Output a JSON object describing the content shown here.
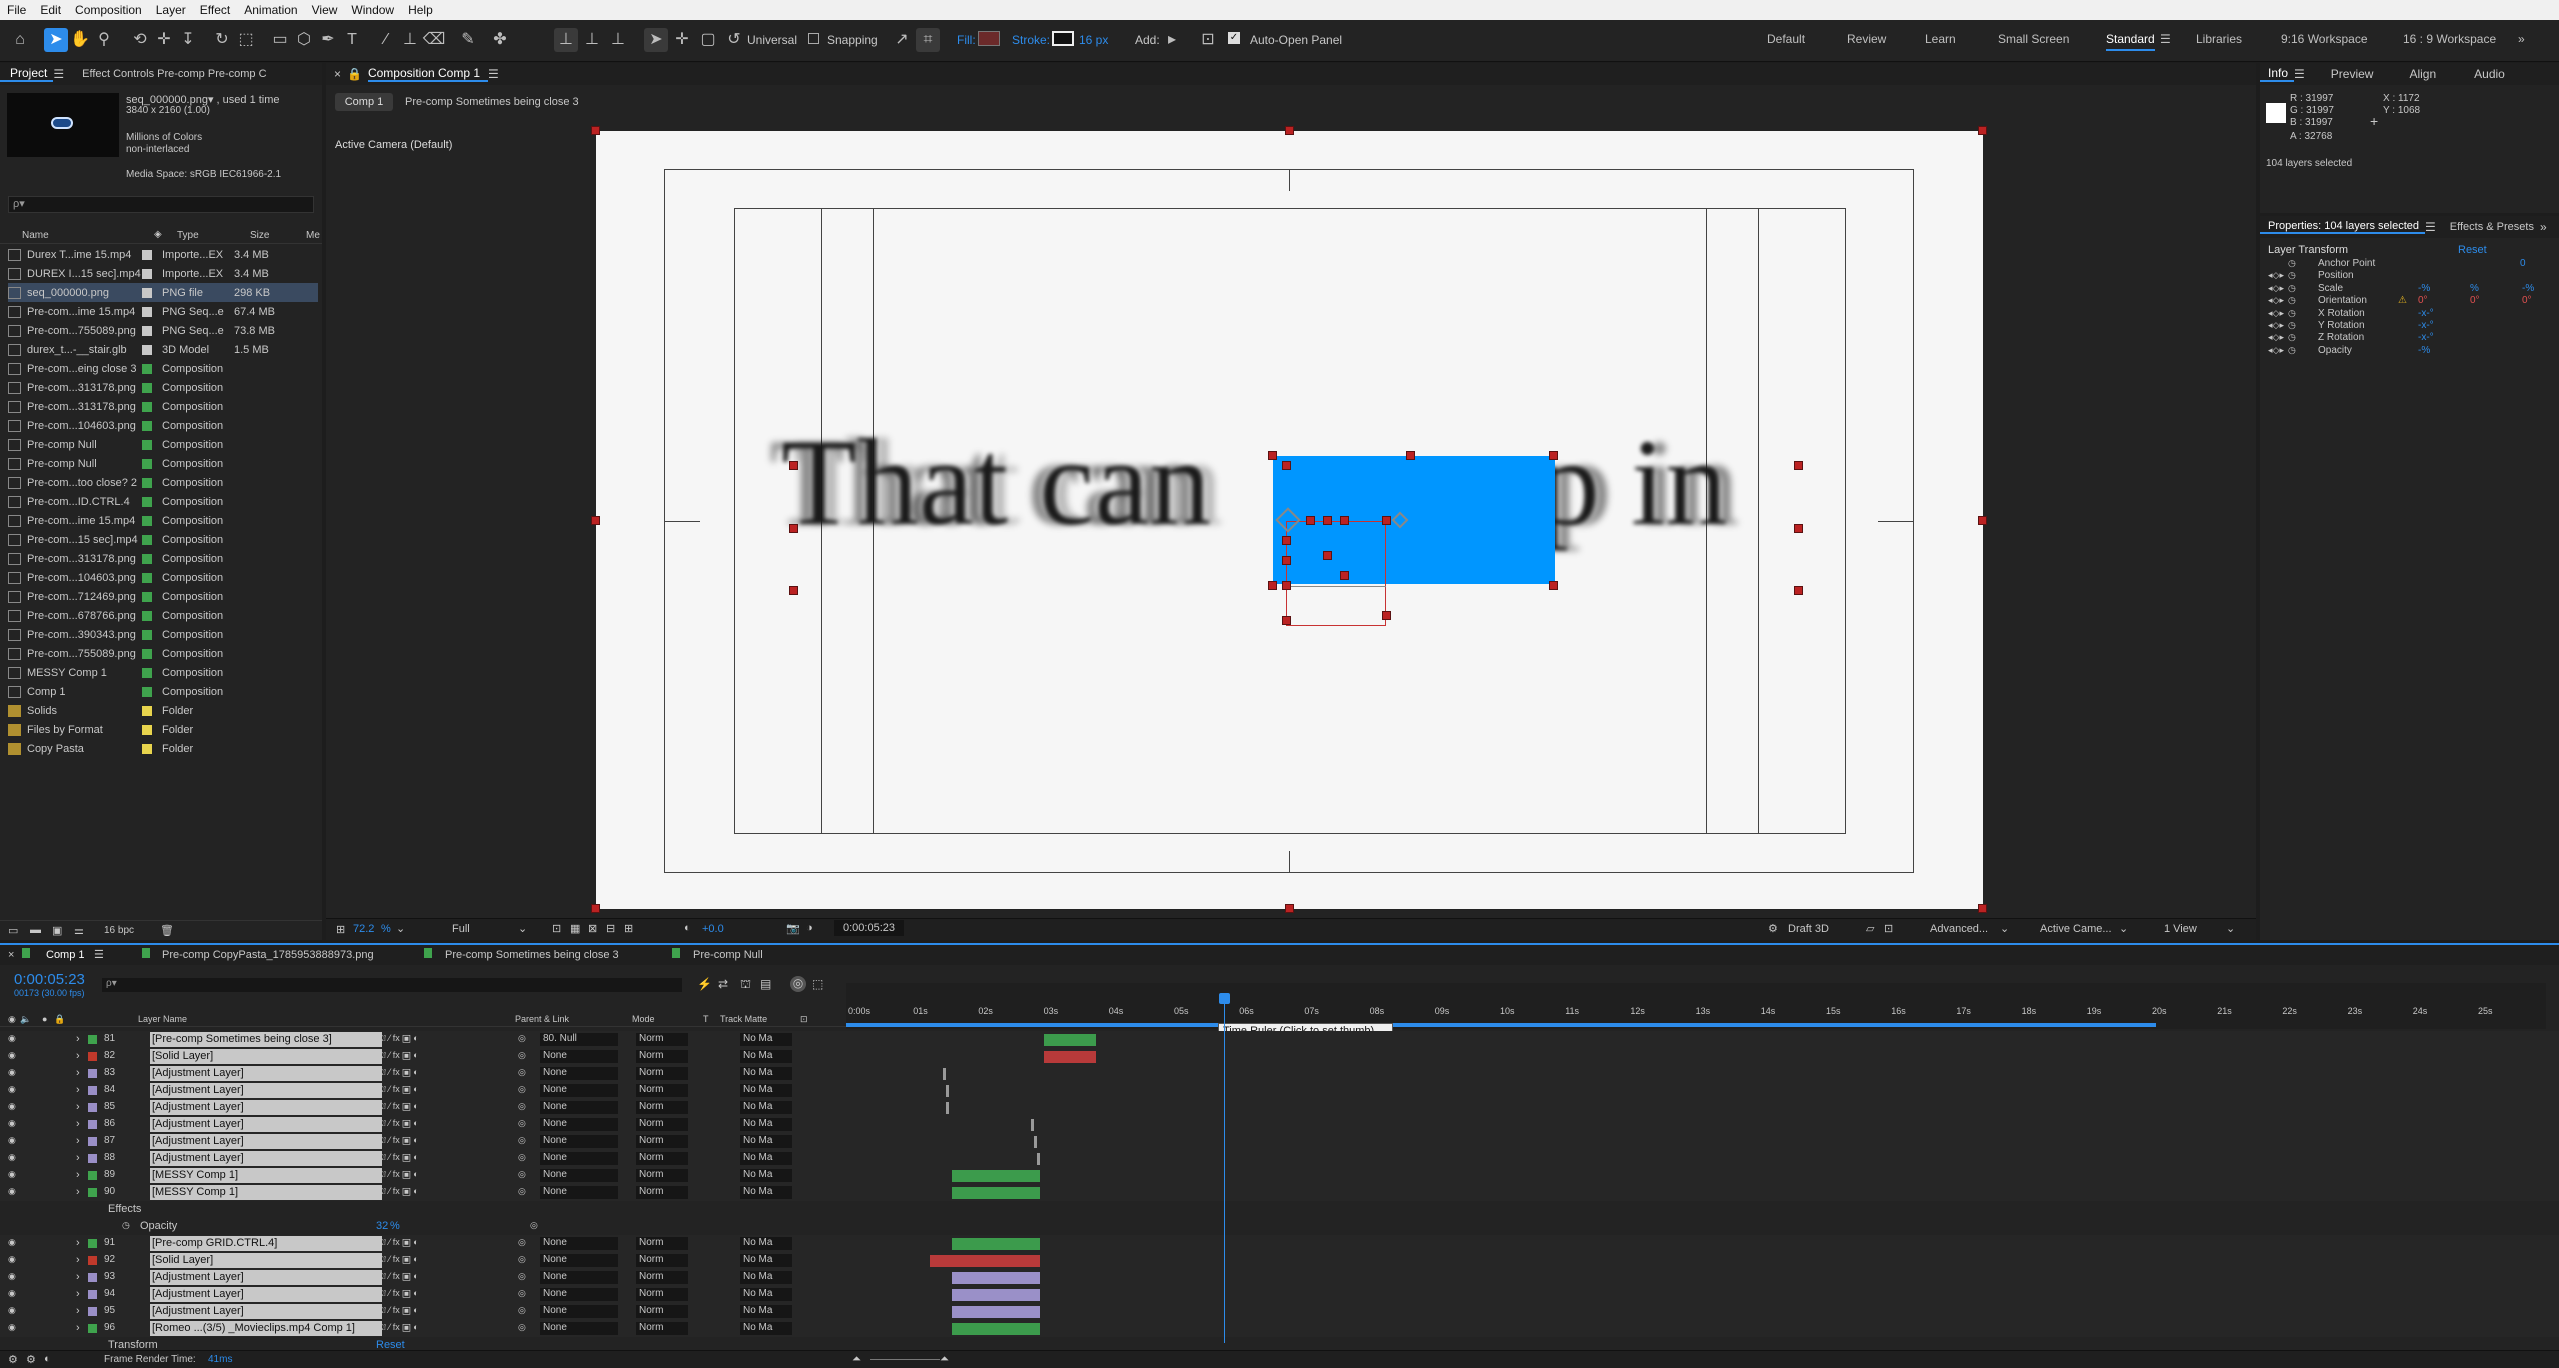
{
  "menu": [
    "File",
    "Edit",
    "Composition",
    "Layer",
    "Effect",
    "Animation",
    "View",
    "Window",
    "Help"
  ],
  "toolbar": {
    "universal": "Universal",
    "snapping": "Snapping",
    "fill": "Fill:",
    "stroke": "Stroke:",
    "stroke_px": "16 px",
    "add": "Add:",
    "auto_open": "Auto-Open Panel"
  },
  "workspaces": [
    "Default",
    "Review",
    "Learn",
    "Small Screen",
    "Standard",
    "Libraries",
    "9:16 Workspace",
    "16 : 9 Workspace"
  ],
  "project": {
    "tab": "Project",
    "effect_tab": "Effect Controls Pre-comp Pre-comp C",
    "selected_name": "seq_000000.png▾ , used 1 time",
    "dims": "3840 x 2160 (1.00)",
    "colors": "Millions of Colors",
    "interlace": "non-interlaced",
    "media_space": "Media Space: sRGB IEC61966-2.1",
    "search_placeholder": "ρ▾",
    "cols": {
      "name": "Name",
      "type": "Type",
      "size": "Size",
      "me": "Me"
    },
    "items": [
      {
        "name": "Durex T...ime 15.mp4",
        "type": "Importe...EX",
        "size": "3.4 MB",
        "color": "#c8c8c8"
      },
      {
        "name": "DUREX I...15 sec].mp4",
        "type": "Importe...EX",
        "size": "3.4 MB",
        "color": "#c8c8c8"
      },
      {
        "name": "seq_000000.png",
        "type": "PNG file",
        "size": "298 KB",
        "color": "#c8c8c8"
      },
      {
        "name": "Pre-com...ime 15.mp4",
        "type": "PNG Seq...e",
        "size": "67.4 MB",
        "color": "#c8c8c8"
      },
      {
        "name": "Pre-com...755089.png",
        "type": "PNG Seq...e",
        "size": "73.8 MB",
        "color": "#c8c8c8"
      },
      {
        "name": "durex_t...-__stair.glb",
        "type": "3D Model",
        "size": "1.5 MB",
        "color": "#c8c8c8"
      },
      {
        "name": "Pre-com...eing close 3",
        "type": "Composition",
        "size": "",
        "color": "#3fa34d"
      },
      {
        "name": "Pre-com...313178.png",
        "type": "Composition",
        "size": "",
        "color": "#3fa34d"
      },
      {
        "name": "Pre-com...313178.png",
        "type": "Composition",
        "size": "",
        "color": "#3fa34d"
      },
      {
        "name": "Pre-com...104603.png",
        "type": "Composition",
        "size": "",
        "color": "#3fa34d"
      },
      {
        "name": "Pre-comp Null",
        "type": "Composition",
        "size": "",
        "color": "#3fa34d"
      },
      {
        "name": "Pre-comp Null",
        "type": "Composition",
        "size": "",
        "color": "#3fa34d"
      },
      {
        "name": "Pre-com...too close? 2",
        "type": "Composition",
        "size": "",
        "color": "#3fa34d"
      },
      {
        "name": "Pre-com...ID.CTRL.4",
        "type": "Composition",
        "size": "",
        "color": "#3fa34d"
      },
      {
        "name": "Pre-com...ime 15.mp4",
        "type": "Composition",
        "size": "",
        "color": "#3fa34d"
      },
      {
        "name": "Pre-com...15 sec].mp4",
        "type": "Composition",
        "size": "",
        "color": "#3fa34d"
      },
      {
        "name": "Pre-com...313178.png",
        "type": "Composition",
        "size": "",
        "color": "#3fa34d"
      },
      {
        "name": "Pre-com...104603.png",
        "type": "Composition",
        "size": "",
        "color": "#3fa34d"
      },
      {
        "name": "Pre-com...712469.png",
        "type": "Composition",
        "size": "",
        "color": "#3fa34d"
      },
      {
        "name": "Pre-com...678766.png",
        "type": "Composition",
        "size": "",
        "color": "#3fa34d"
      },
      {
        "name": "Pre-com...390343.png",
        "type": "Composition",
        "size": "",
        "color": "#3fa34d"
      },
      {
        "name": "Pre-com...755089.png",
        "type": "Composition",
        "size": "",
        "color": "#3fa34d"
      },
      {
        "name": "MESSY Comp 1",
        "type": "Composition",
        "size": "",
        "color": "#3fa34d"
      },
      {
        "name": "Comp 1",
        "type": "Composition",
        "size": "",
        "color": "#3fa34d"
      },
      {
        "name": "Solids",
        "type": "Folder",
        "size": "",
        "color": "#e8d44d"
      },
      {
        "name": "Files by Format",
        "type": "Folder",
        "size": "",
        "color": "#e8d44d"
      },
      {
        "name": "Copy Pasta",
        "type": "Folder",
        "size": "",
        "color": "#e8d44d"
      }
    ],
    "bpc": "16 bpc"
  },
  "comp": {
    "tab": "Composition Comp 1",
    "crumb1": "Comp 1",
    "crumb2": "Pre-comp Sometimes being close 3",
    "camera": "Active Camera (Default)",
    "text_left": "That can",
    "text_right": "up in",
    "zoom": "72.2",
    "zoom_unit": "%",
    "res": "Full",
    "exposure": "+0.0",
    "timecode": "0:00:05:23",
    "renderer": "Draft 3D",
    "advanced": "Advanced...",
    "active_cam": "Active Came...",
    "views": "1 View"
  },
  "info": {
    "tabs": [
      "Info",
      "Preview",
      "Align",
      "Audio"
    ],
    "r": "R : 31997",
    "g": "G : 31997",
    "b": "B : 31997",
    "a": "A : 32768",
    "x": "X : 1172",
    "y": "Y : 1068",
    "selected": "104 layers selected"
  },
  "props": {
    "title": "Properties: 104 layers selected",
    "effects_tab": "Effects & Presets",
    "section": "Layer Transform",
    "reset": "Reset",
    "rows": [
      "Anchor Point",
      "Position",
      "Scale",
      "Orientation",
      "X Rotation",
      "Y Rotation",
      "Z Rotation",
      "Opacity"
    ],
    "scale_vals": [
      "-%",
      "%",
      "-%"
    ],
    "orient_vals": [
      "0°",
      "0°",
      "0°"
    ],
    "rot_vals": [
      "-x-°",
      "-x-°",
      "-x-°"
    ],
    "opacity_val": "-%",
    "anchor_z": "0"
  },
  "timeline": {
    "tabs": [
      "Comp 1",
      "Pre-comp CopyPasta_1785953888973.png",
      "Pre-comp Sometimes being close 3",
      "Pre-comp Null"
    ],
    "timecode": "0:00:05:23",
    "fps": "00173 (30.00 fps)",
    "search_placeholder": "ρ▾",
    "cols": {
      "layer": "Layer Name",
      "parent": "Parent & Link",
      "mode": "Mode",
      "t": "T",
      "matte": "Track Matte"
    },
    "ruler": [
      "0:00s",
      "01s",
      "02s",
      "03s",
      "04s",
      "05s",
      "06s",
      "07s",
      "08s",
      "09s",
      "10s",
      "11s",
      "12s",
      "13s",
      "14s",
      "15s",
      "16s",
      "17s",
      "18s",
      "19s",
      "20s",
      "21s",
      "22s",
      "23s",
      "24s",
      "25s"
    ],
    "tooltip": "Time Ruler (Click to set thumb)",
    "layers": [
      {
        "num": "81",
        "name": "[Pre-comp Sometimes being close 3]",
        "color": "#3fa34d",
        "parent": "80. Null",
        "mode": "Norm",
        "matte": "No Ma",
        "bar": {
          "s": 3.0,
          "e": 3.8,
          "c": "#3c9b4c"
        }
      },
      {
        "num": "82",
        "name": "[Solid Layer]",
        "color": "#c0392b",
        "parent": "None",
        "mode": "Norm",
        "matte": "No Ma",
        "bar": {
          "s": 3.0,
          "e": 3.8,
          "c": "#b83a3a"
        }
      },
      {
        "num": "83",
        "name": "[Adjustment Layer]",
        "color": "#9a8fc7",
        "parent": "None",
        "mode": "Norm",
        "matte": "No Ma",
        "bar": {
          "s": 1.45,
          "e": 1.5,
          "c": "#999"
        }
      },
      {
        "num": "84",
        "name": "[Adjustment Layer]",
        "color": "#9a8fc7",
        "parent": "None",
        "mode": "Norm",
        "matte": "No Ma",
        "bar": {
          "s": 1.5,
          "e": 1.55,
          "c": "#999"
        }
      },
      {
        "num": "85",
        "name": "[Adjustment Layer]",
        "color": "#9a8fc7",
        "parent": "None",
        "mode": "Norm",
        "matte": "No Ma",
        "bar": {
          "s": 1.5,
          "e": 1.55,
          "c": "#999"
        }
      },
      {
        "num": "86",
        "name": "[Adjustment Layer]",
        "color": "#9a8fc7",
        "parent": "None",
        "mode": "Norm",
        "matte": "No Ma",
        "bar": {
          "s": 2.8,
          "e": 2.85,
          "c": "#999"
        }
      },
      {
        "num": "87",
        "name": "[Adjustment Layer]",
        "color": "#9a8fc7",
        "parent": "None",
        "mode": "Norm",
        "matte": "No Ma",
        "bar": {
          "s": 2.85,
          "e": 2.9,
          "c": "#999"
        }
      },
      {
        "num": "88",
        "name": "[Adjustment Layer]",
        "color": "#9a8fc7",
        "parent": "None",
        "mode": "Norm",
        "matte": "No Ma",
        "bar": {
          "s": 2.9,
          "e": 2.95,
          "c": "#999"
        }
      },
      {
        "num": "89",
        "name": "[MESSY Comp 1]",
        "color": "#3fa34d",
        "parent": "None",
        "mode": "Norm",
        "matte": "No Ma",
        "bar": {
          "s": 1.6,
          "e": 2.95,
          "c": "#3c9b4c"
        }
      },
      {
        "num": "90",
        "name": "[MESSY Comp 1]",
        "color": "#3fa34d",
        "parent": "None",
        "mode": "Norm",
        "matte": "No Ma",
        "bar": {
          "s": 1.6,
          "e": 2.95,
          "c": "#3c9b4c"
        }
      },
      {
        "num": "91",
        "name": "[Pre-comp GRID.CTRL.4]",
        "color": "#3fa34d",
        "parent": "None",
        "mode": "Norm",
        "matte": "No Ma",
        "bar": {
          "s": 1.6,
          "e": 2.95,
          "c": "#3c9b4c"
        }
      },
      {
        "num": "92",
        "name": "[Solid Layer]",
        "color": "#c0392b",
        "parent": "None",
        "mode": "Norm",
        "matte": "No Ma",
        "bar": {
          "s": 1.25,
          "e": 2.95,
          "c": "#b83a3a"
        }
      },
      {
        "num": "93",
        "name": "[Adjustment Layer]",
        "color": "#9a8fc7",
        "parent": "None",
        "mode": "Norm",
        "matte": "No Ma",
        "bar": {
          "s": 1.6,
          "e": 2.95,
          "c": "#9a90c8"
        }
      },
      {
        "num": "94",
        "name": "[Adjustment Layer]",
        "color": "#9a8fc7",
        "parent": "None",
        "mode": "Norm",
        "matte": "No Ma",
        "bar": {
          "s": 1.6,
          "e": 2.95,
          "c": "#9a90c8"
        }
      },
      {
        "num": "95",
        "name": "[Adjustment Layer]",
        "color": "#9a8fc7",
        "parent": "None",
        "mode": "Norm",
        "matte": "No Ma",
        "bar": {
          "s": 1.6,
          "e": 2.95,
          "c": "#9a90c8"
        }
      },
      {
        "num": "96",
        "name": "[Romeo ...(3/5) _Movieclips.mp4 Comp 1]",
        "color": "#3fa34d",
        "parent": "None",
        "mode": "Norm",
        "matte": "No Ma",
        "bar": {
          "s": 1.6,
          "e": 2.95,
          "c": "#3c9b4c"
        }
      }
    ],
    "effects_label": "Effects",
    "opacity_label": "Opacity",
    "opacity_val": "32",
    "opacity_unit": "%",
    "transform_label": "Transform",
    "reset": "Reset",
    "frame_render": "Frame Render Time:",
    "frame_render_val": "41ms"
  },
  "colors": {
    "accent": "#2d8ceb",
    "selection_blue": "#0096ff",
    "handle": "#c83232"
  }
}
